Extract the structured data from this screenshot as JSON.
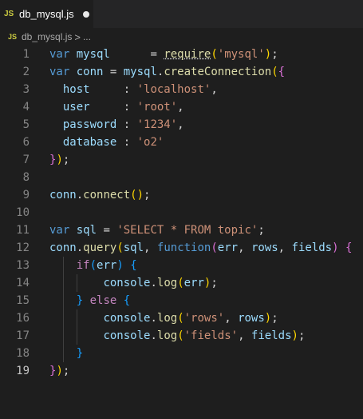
{
  "tab": {
    "icon": "JS",
    "title": "db_mysql.js"
  },
  "breadcrumb": {
    "icon": "JS",
    "file": "db_mysql.js",
    "separator": ">",
    "more": "..."
  },
  "lines": [
    {
      "n": "1",
      "tokens": [
        [
          "k",
          "var "
        ],
        [
          "v",
          "mysql"
        ],
        [
          "p",
          "      = "
        ],
        [
          "f",
          "require"
        ],
        [
          "b1",
          "("
        ],
        [
          "s",
          "'mysql'"
        ],
        [
          "b1",
          ")"
        ],
        [
          "p",
          ";"
        ]
      ]
    },
    {
      "n": "2",
      "tokens": [
        [
          "k",
          "var "
        ],
        [
          "v",
          "conn"
        ],
        [
          "p",
          " = "
        ],
        [
          "v",
          "mysql"
        ],
        [
          "p",
          "."
        ],
        [
          "f",
          "createConnection"
        ],
        [
          "b1",
          "("
        ],
        [
          "b2",
          "{"
        ]
      ]
    },
    {
      "n": "3",
      "tokens": [
        [
          "p",
          "  "
        ],
        [
          "v",
          "host"
        ],
        [
          "p",
          "     : "
        ],
        [
          "s",
          "'localhost'"
        ],
        [
          "p",
          ","
        ]
      ]
    },
    {
      "n": "4",
      "tokens": [
        [
          "p",
          "  "
        ],
        [
          "v",
          "user"
        ],
        [
          "p",
          "     : "
        ],
        [
          "s",
          "'root'"
        ],
        [
          "p",
          ","
        ]
      ]
    },
    {
      "n": "5",
      "tokens": [
        [
          "p",
          "  "
        ],
        [
          "v",
          "password"
        ],
        [
          "p",
          " : "
        ],
        [
          "s",
          "'1234'"
        ],
        [
          "p",
          ","
        ]
      ]
    },
    {
      "n": "6",
      "tokens": [
        [
          "p",
          "  "
        ],
        [
          "v",
          "database"
        ],
        [
          "p",
          " : "
        ],
        [
          "s",
          "'o2'"
        ]
      ]
    },
    {
      "n": "7",
      "tokens": [
        [
          "b2",
          "}"
        ],
        [
          "b1",
          ")"
        ],
        [
          "p",
          ";"
        ]
      ]
    },
    {
      "n": "8",
      "tokens": []
    },
    {
      "n": "9",
      "tokens": [
        [
          "v",
          "conn"
        ],
        [
          "p",
          "."
        ],
        [
          "f",
          "connect"
        ],
        [
          "b1",
          "()"
        ],
        [
          "p",
          ";"
        ]
      ]
    },
    {
      "n": "10",
      "tokens": []
    },
    {
      "n": "11",
      "tokens": [
        [
          "k",
          "var "
        ],
        [
          "v",
          "sql"
        ],
        [
          "p",
          " = "
        ],
        [
          "s",
          "'SELECT * FROM topic'"
        ],
        [
          "p",
          ";"
        ]
      ]
    },
    {
      "n": "12",
      "tokens": [
        [
          "v",
          "conn"
        ],
        [
          "p",
          "."
        ],
        [
          "f",
          "query"
        ],
        [
          "b1",
          "("
        ],
        [
          "v",
          "sql"
        ],
        [
          "p",
          ", "
        ],
        [
          "k",
          "function"
        ],
        [
          "b2",
          "("
        ],
        [
          "v",
          "err"
        ],
        [
          "p",
          ", "
        ],
        [
          "v",
          "rows"
        ],
        [
          "p",
          ", "
        ],
        [
          "v",
          "fields"
        ],
        [
          "b2",
          ")"
        ],
        [
          "p",
          " "
        ],
        [
          "b2",
          "{"
        ]
      ]
    },
    {
      "n": "13",
      "tokens": [
        [
          "p",
          "    "
        ],
        [
          "c",
          "if"
        ],
        [
          "b3",
          "("
        ],
        [
          "v",
          "err"
        ],
        [
          "b3",
          ")"
        ],
        [
          "p",
          " "
        ],
        [
          "b3",
          "{"
        ]
      ]
    },
    {
      "n": "14",
      "tokens": [
        [
          "p",
          "        "
        ],
        [
          "v",
          "console"
        ],
        [
          "p",
          "."
        ],
        [
          "f",
          "log"
        ],
        [
          "b1",
          "("
        ],
        [
          "v",
          "err"
        ],
        [
          "b1",
          ")"
        ],
        [
          "p",
          ";"
        ]
      ]
    },
    {
      "n": "15",
      "tokens": [
        [
          "p",
          "    "
        ],
        [
          "b3",
          "}"
        ],
        [
          "p",
          " "
        ],
        [
          "c",
          "else"
        ],
        [
          "p",
          " "
        ],
        [
          "b3",
          "{"
        ]
      ]
    },
    {
      "n": "16",
      "tokens": [
        [
          "p",
          "        "
        ],
        [
          "v",
          "console"
        ],
        [
          "p",
          "."
        ],
        [
          "f",
          "log"
        ],
        [
          "b1",
          "("
        ],
        [
          "s",
          "'rows'"
        ],
        [
          "p",
          ", "
        ],
        [
          "v",
          "rows"
        ],
        [
          "b1",
          ")"
        ],
        [
          "p",
          ";"
        ]
      ]
    },
    {
      "n": "17",
      "tokens": [
        [
          "p",
          "        "
        ],
        [
          "v",
          "console"
        ],
        [
          "p",
          "."
        ],
        [
          "f",
          "log"
        ],
        [
          "b1",
          "("
        ],
        [
          "s",
          "'fields'"
        ],
        [
          "p",
          ", "
        ],
        [
          "v",
          "fields"
        ],
        [
          "b1",
          ")"
        ],
        [
          "p",
          ";"
        ]
      ]
    },
    {
      "n": "18",
      "tokens": [
        [
          "p",
          "    "
        ],
        [
          "b3",
          "}"
        ]
      ]
    },
    {
      "n": "19",
      "tokens": [
        [
          "b2",
          "}"
        ],
        [
          "b1",
          ")"
        ],
        [
          "p",
          ";"
        ]
      ]
    }
  ]
}
